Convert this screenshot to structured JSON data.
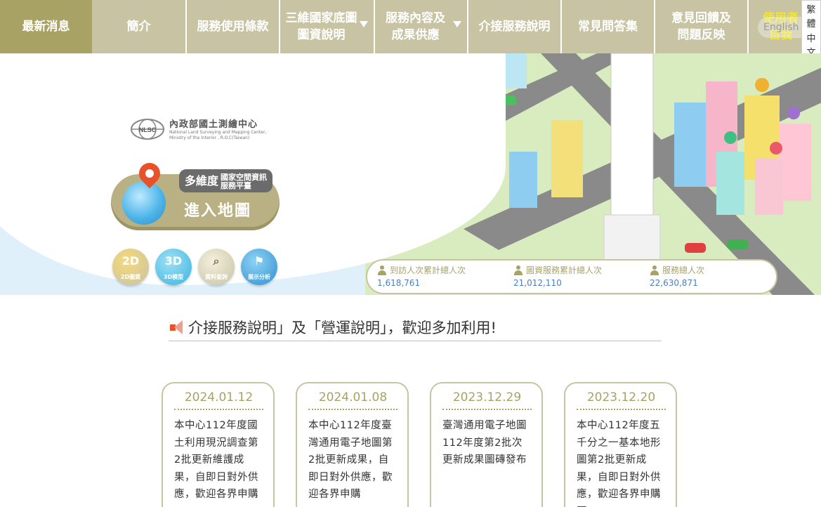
{
  "nav": {
    "items": [
      {
        "label": "最新消息",
        "active": true
      },
      {
        "label": "簡介"
      },
      {
        "label": "服務使用條款"
      },
      {
        "label": "三維國家底圖\n圖資說明",
        "dropdown": true
      },
      {
        "label": "服務內容及\n成果供應",
        "dropdown": true
      },
      {
        "label": "介接服務說明"
      },
      {
        "label": "常見問答集"
      },
      {
        "label": "意見回饋及\n問題反映"
      }
    ],
    "user_label": "使用者\n自我",
    "english": "English",
    "lang_tab": [
      "繁",
      "體",
      "中",
      "文"
    ]
  },
  "hero": {
    "org_title": "內政部國土測繪中心",
    "org_sub_en": "National Land Surveying and Mapping Center,\nMinistry of the Interior , R.O.C(Taiwan)",
    "org_abbr": "NLSC",
    "platform_big": "多維度",
    "platform_small": "國家空間資訊\n服務平臺",
    "enter_label": "進入地圖",
    "tools": [
      {
        "icon": "2d-map-icon",
        "label": "2D圖資",
        "glyph": "2D",
        "color": "#e8b640"
      },
      {
        "icon": "3d-model-icon",
        "label": "3D模型",
        "glyph": "3D",
        "color": "#3ab4e0"
      },
      {
        "icon": "data-query-icon",
        "label": "資料查詢",
        "glyph": "⌕",
        "color": "#c7c3a3"
      },
      {
        "icon": "display-analysis-icon",
        "label": "展示分析",
        "glyph": "⚑",
        "color": "#3aa0dc"
      }
    ]
  },
  "stats": [
    {
      "label": "到訪人次累計總人次",
      "value": "1,618,761"
    },
    {
      "label": "圖資服務累計總人次",
      "value": "21,012,110"
    },
    {
      "label": "服務總人次",
      "value": "22,630,871"
    }
  ],
  "marquee": {
    "text": "介接服務說明」及「營運說明」，歡迎多加利用!"
  },
  "news": [
    {
      "date": "2024.01.12",
      "text": "本中心112年度國土利用現況調查第2批更新維護成果，自即日對外供應，歡迎各界申購"
    },
    {
      "date": "2024.01.08",
      "text": "本中心112年度臺灣通用電子地圖第2批更新成果，自即日對外供應，歡迎各界申購"
    },
    {
      "date": "2023.12.29",
      "text": "臺灣通用電子地圖112年度第2批次更新成果圖磚發布"
    },
    {
      "date": "2023.12.20",
      "text": "本中心112年度五千分之一基本地形圖第2批更新成果，自即日對外供應，歡迎各界申購圖"
    }
  ],
  "colors": {
    "nav_bg": "#c7c3a3",
    "nav_active": "#a8a364",
    "accent": "#a8a364",
    "stat_value": "#4a7fc0",
    "user_label": "#f3e628"
  }
}
